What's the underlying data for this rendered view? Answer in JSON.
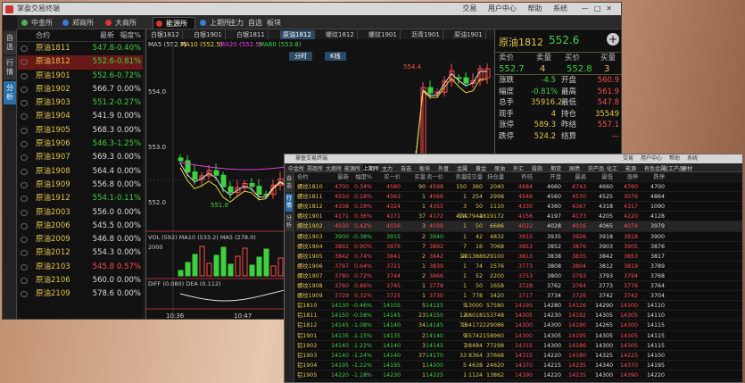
{
  "app": {
    "title": "掌盈交易终端",
    "menu": [
      "交易",
      "用户中心",
      "帮助",
      "系统"
    ],
    "controls": [
      "—",
      "□",
      "✕"
    ]
  },
  "tabs": [
    {
      "label": "中金所",
      "color": "#4caf50"
    },
    {
      "label": "郑商所",
      "color": "#3a7bd5"
    },
    {
      "label": "大商所",
      "color": "#d33"
    },
    {
      "label": "能源所",
      "color": "#d33"
    },
    {
      "label": "上期所",
      "color": "#3a7bd5"
    },
    {
      "label": "主力",
      "color": ""
    },
    {
      "label": "自选",
      "color": ""
    },
    {
      "label": "板块",
      "color": ""
    }
  ],
  "side": [
    "自选",
    "行情",
    "分析"
  ],
  "list": {
    "headers": [
      "合约",
      "最新",
      "幅度%"
    ],
    "rows": [
      {
        "name": "原油1811",
        "price": "547.8",
        "chg": "-0.40%",
        "dir": "dn"
      },
      {
        "name": "原油1812",
        "price": "552.6",
        "chg": "-0.81%",
        "dir": "dn"
      },
      {
        "name": "原油1901",
        "price": "552.6",
        "chg": "-0.72%",
        "dir": "dn"
      },
      {
        "name": "原油1902",
        "price": "566.7",
        "chg": "0.00%",
        "dir": "wh"
      },
      {
        "name": "原油1903",
        "price": "551.2",
        "chg": "-0.27%",
        "dir": "dn"
      },
      {
        "name": "原油1904",
        "price": "541.9",
        "chg": "0.00%",
        "dir": "wh"
      },
      {
        "name": "原油1905",
        "price": "568.3",
        "chg": "0.00%",
        "dir": "wh"
      },
      {
        "name": "原油1906",
        "price": "546.3",
        "chg": "-1.25%",
        "dir": "dn"
      },
      {
        "name": "原油1907",
        "price": "569.3",
        "chg": "0.00%",
        "dir": "wh"
      },
      {
        "name": "原油1908",
        "price": "564.4",
        "chg": "0.00%",
        "dir": "wh"
      },
      {
        "name": "原油1909",
        "price": "556.8",
        "chg": "0.00%",
        "dir": "wh"
      },
      {
        "name": "原油1912",
        "price": "554.1",
        "chg": "-0.11%",
        "dir": "dn"
      },
      {
        "name": "原油2003",
        "price": "556.0",
        "chg": "0.00%",
        "dir": "wh"
      },
      {
        "name": "原油2006",
        "price": "545.5",
        "chg": "0.00%",
        "dir": "wh"
      },
      {
        "name": "原油2009",
        "price": "546.8",
        "chg": "0.00%",
        "dir": "wh"
      },
      {
        "name": "原油2012",
        "price": "554.3",
        "chg": "0.00%",
        "dir": "wh"
      },
      {
        "name": "原油2103",
        "price": "545.8",
        "chg": "0.57%",
        "dir": "up"
      },
      {
        "name": "原油2106",
        "price": "560.0",
        "chg": "0.00%",
        "dir": "wh"
      },
      {
        "name": "原油2109",
        "price": "578.6",
        "chg": "0.00%",
        "dir": "wh"
      }
    ]
  },
  "chart": {
    "tabs": [
      "白银1812",
      "白银1901",
      "白银1811",
      "原油1812",
      "螺纹1812",
      "螺纹1901",
      "沥青1901",
      "原油1901"
    ],
    "ma": {
      "ma5": "MA5 (552.7)",
      "ma10": "MA10 (552.5)",
      "ma20": "MA20 (552.5)",
      "ma60": "MA60 (553.8)"
    },
    "buttons": [
      "分时",
      "K线"
    ],
    "high_label": "554.4",
    "low_label": "551.8",
    "y_labels": [
      "554.0",
      "553.0",
      "552.0"
    ],
    "vol": "VOL (592)  MA10 (533.2)  MA5 (278.0)",
    "vol_y": "2000",
    "diff": "DIFF (0.080)  DEA (0.112)",
    "times": [
      "10:36",
      "10:47"
    ]
  },
  "quote": {
    "name": "原油1812",
    "price": "552.6",
    "labels": {
      "sell": "卖价",
      "sellq": "卖量",
      "buy": "买价",
      "buyq": "买量"
    },
    "sell": "552.7",
    "sellq": "4",
    "buy": "552.8",
    "buyq": "3",
    "rows": [
      {
        "l": "涨跌",
        "v": "-4.5",
        "l2": "开盘",
        "v2": "560.9"
      },
      {
        "l": "幅度",
        "v": "-0.81%",
        "l2": "最高",
        "v2": "561.9"
      },
      {
        "l": "总手",
        "v": "35916.2",
        "l2": "最低",
        "v2": "547.8"
      },
      {
        "l": "现手",
        "v": "4",
        "l2": "持仓",
        "v2": "35549"
      },
      {
        "l": "涨停",
        "v": "589.3",
        "l2": "昨结",
        "v2": "557.1"
      },
      {
        "l": "跌停",
        "v": "524.2",
        "l2": "结算",
        "v2": "—"
      }
    ]
  },
  "win2": {
    "title": "掌盈交易终端",
    "menu": [
      "交易",
      "用户中心",
      "帮助",
      "系统"
    ],
    "tabs": [
      "中金所",
      "郑商所",
      "大商所",
      "能源所",
      "上期所",
      "主力",
      "自选",
      "板块",
      "外盘",
      "金属",
      "黄金",
      "原油",
      "外汇",
      "股指",
      "期货",
      "国债",
      "农产品",
      "化工",
      "能源",
      "有色金属",
      "化工产品",
      "建材"
    ],
    "side": [
      "自选",
      "行情",
      "分析"
    ],
    "headers": [
      "合约",
      "最新",
      "幅度%",
      "买一价",
      "买量",
      "卖一价",
      "卖量",
      "成交量",
      "持仓量",
      "昨结",
      "开盘",
      "最高",
      "最低",
      "涨停",
      "跌停"
    ],
    "rows": [
      [
        "螺纹1810",
        "4700",
        "0.34%",
        "4580",
        "90",
        "4598",
        "150",
        "360",
        "2040",
        "4684",
        "4660",
        "4743",
        "4660",
        "4760",
        "4700"
      ],
      [
        "螺纹1811",
        "4550",
        "0.18%",
        "4563",
        "1",
        "4566",
        "1",
        "254",
        "2998",
        "4546",
        "4560",
        "4570",
        "4525",
        "3076",
        "4864"
      ],
      [
        "螺纹1812",
        "4338",
        "0.18%",
        "4324",
        "1",
        "4355",
        "3",
        "50",
        "1110",
        "4330",
        "4360",
        "4367",
        "4318",
        "4317",
        "1090"
      ],
      [
        "螺纹1901",
        "4171",
        "0.36%",
        "4171",
        "37",
        "4172",
        "474",
        "3117944",
        "2819172",
        "4156",
        "4197",
        "4173",
        "4205",
        "4220",
        "4128"
      ],
      [
        "螺纹1902",
        "4030",
        "0.42%",
        "4016",
        "3",
        "4039",
        "1",
        "50",
        "6686",
        "4022",
        "4028",
        "4016",
        "4065",
        "4074",
        "3979"
      ],
      [
        "螺纹1903",
        "3900",
        "-0.38%",
        "3915",
        "2",
        "3940",
        "1",
        "42",
        "4832",
        "3915",
        "3935",
        "3926",
        "3918",
        "3918",
        "3900"
      ],
      [
        "螺纹1904",
        "3892",
        "0.90%",
        "3876",
        "7",
        "3892",
        "7",
        "16",
        "7068",
        "3853",
        "3852",
        "3876",
        "3903",
        "3905",
        "3876"
      ],
      [
        "螺纹1905",
        "3842",
        "0.74%",
        "3841",
        "2",
        "3842",
        "14",
        "231388",
        "629100",
        "3813",
        "3838",
        "3835",
        "3842",
        "3853",
        "3817"
      ],
      [
        "螺纹1906",
        "3797",
        "0.64%",
        "3721",
        "1",
        "3839",
        "1",
        "74",
        "1576",
        "3773",
        "3808",
        "3804",
        "3812",
        "3819",
        "3789"
      ],
      [
        "螺纹1907",
        "3780",
        "0.72%",
        "3744",
        "2",
        "3866",
        "1",
        "52",
        "2200",
        "3753",
        "3800",
        "3793",
        "3793",
        "3794",
        "3768"
      ],
      [
        "螺纹1908",
        "3760",
        "0.86%",
        "3745",
        "1",
        "3778",
        "1",
        "50",
        "1658",
        "3728",
        "3762",
        "3764",
        "3773",
        "3776",
        "3764"
      ],
      [
        "螺纹1909",
        "3729",
        "0.32%",
        "3725",
        "1",
        "3730",
        "1",
        "778",
        "3420",
        "3717",
        "3734",
        "3726",
        "3742",
        "3742",
        "3704"
      ],
      [
        "铝1810",
        "14130",
        "-0.46%",
        "14105",
        "5",
        "14125",
        "5",
        "13000",
        "57580",
        "14195",
        "14280",
        "14126",
        "14290",
        "14300",
        "14110"
      ],
      [
        "铝1811",
        "14150",
        "-0.58%",
        "14145",
        "23",
        "14150",
        "12",
        "68018",
        "153748",
        "14305",
        "14230",
        "14192",
        "14305",
        "14305",
        "14110"
      ],
      [
        "铝1812",
        "14145",
        "-1.08%",
        "14140",
        "34",
        "14145",
        "73",
        "164172",
        "229086",
        "14300",
        "14300",
        "14190",
        "14265",
        "14300",
        "14115"
      ],
      [
        "铝1901",
        "14135",
        "-1.15%",
        "14135",
        "2",
        "14140",
        "9",
        "55742",
        "158960",
        "14300",
        "14305",
        "14195",
        "14305",
        "14305",
        "14115"
      ],
      [
        "铝1902",
        "14140",
        "-1.22%",
        "14140",
        "3",
        "14145",
        "7",
        "28484",
        "77298",
        "14315",
        "14300",
        "14186",
        "14300",
        "14305",
        "14115"
      ],
      [
        "铝1903",
        "14140",
        "-1.24%",
        "14140",
        "37",
        "14170",
        "33",
        "8364",
        "37668",
        "14315",
        "14220",
        "14180",
        "14325",
        "14225",
        "14100"
      ],
      [
        "铝1904",
        "14195",
        "-1.22%",
        "14195",
        "1",
        "14200",
        "5",
        "4638",
        "24620",
        "14370",
        "14215",
        "14235",
        "14340",
        "14370",
        "14195"
      ],
      [
        "铝1905",
        "14220",
        "-1.18%",
        "14230",
        "1",
        "14225",
        "1",
        "1124",
        "13862",
        "14390",
        "14220",
        "14235",
        "14300",
        "14390",
        "14220"
      ]
    ]
  }
}
